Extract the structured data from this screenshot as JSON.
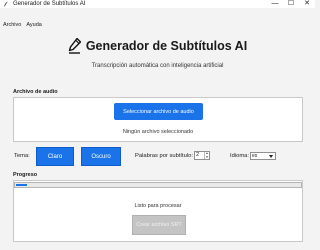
{
  "window": {
    "title": "Generador de Subtítulos AI",
    "controls": {
      "minimize": "—",
      "maximize": "☐",
      "close": "✕"
    }
  },
  "menu": {
    "items": [
      "Archivo",
      "Ayuda"
    ]
  },
  "header": {
    "title": "Generador de Subtítulos AI",
    "subtitle": "Transcripción automática con inteligencia artificial"
  },
  "audio": {
    "section_label": "Archivo de audio",
    "select_button": "Seleccionar archivo de audio",
    "status": "Ningún archivo seleccionado"
  },
  "options": {
    "theme_label": "Tema:",
    "theme_light": "Claro",
    "theme_dark": "Oscuro",
    "words_label": "Palabras por subtítulo:",
    "words_value": "2",
    "language_label": "Idioma:",
    "language_value": "es"
  },
  "progress": {
    "section_label": "Progreso",
    "value": 0.04,
    "status": "Listo para procesar",
    "export_button": "Crear archivo SRT"
  },
  "colors": {
    "accent": "#1a73e8",
    "disabled": "#c4c4c4"
  }
}
